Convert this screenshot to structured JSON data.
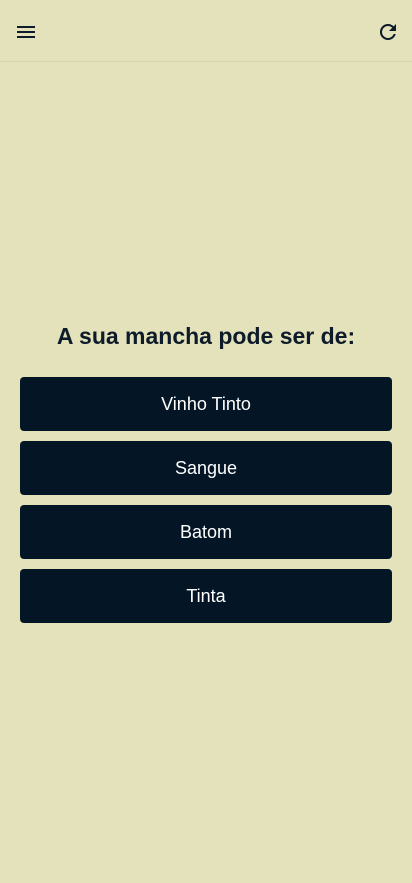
{
  "header": {
    "menu_icon": "hamburger-menu-icon",
    "refresh_icon": "refresh-icon"
  },
  "quiz": {
    "question": "A sua mancha pode ser de:",
    "options": [
      {
        "label": "Vinho Tinto"
      },
      {
        "label": "Sangue"
      },
      {
        "label": "Batom"
      },
      {
        "label": "Tinta"
      }
    ]
  },
  "colors": {
    "background": "#e4e2bb",
    "button": "#041626",
    "button_text": "#ffffff",
    "heading": "#0d1b2a"
  }
}
